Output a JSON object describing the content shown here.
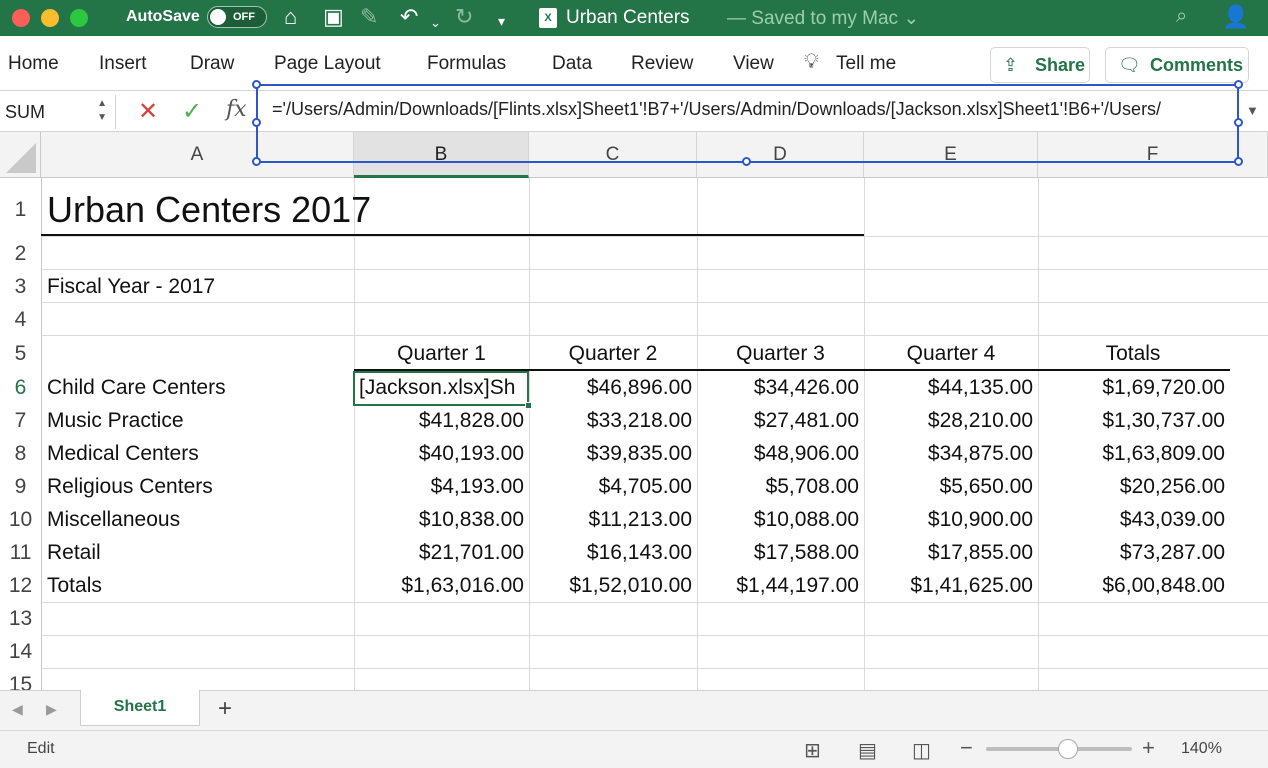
{
  "titlebar": {
    "autosave_label": "AutoSave",
    "autosave_state": "OFF",
    "file_badge": "X",
    "doc_name": "Urban Centers",
    "doc_status": "— Saved to my Mac ⌄"
  },
  "ribbon": {
    "tabs": [
      "Home",
      "Insert",
      "Draw",
      "Page Layout",
      "Formulas",
      "Data",
      "Review",
      "View"
    ],
    "tell_me": "Tell me",
    "share": "Share",
    "comments": "Comments"
  },
  "formula_bar": {
    "name_box": "SUM",
    "formula": "='/Users/Admin/Downloads/[Flints.xlsx]Sheet1'!B7+'/Users/Admin/Downloads/[Jackson.xlsx]Sheet1'!B6+'/Users/"
  },
  "grid": {
    "columns": [
      "A",
      "B",
      "C",
      "D",
      "E",
      "F"
    ],
    "rows": [
      "1",
      "2",
      "3",
      "4",
      "5",
      "6",
      "7",
      "8",
      "9",
      "10",
      "11",
      "12",
      "13",
      "14",
      "15"
    ],
    "title": "Urban Centers 2017",
    "fiscal_year": "Fiscal Year - 2017",
    "headers": [
      "Quarter 1",
      "Quarter 2",
      "Quarter 3",
      "Quarter 4",
      "Totals"
    ],
    "data_rows": [
      {
        "label": "Child Care Centers",
        "values": [
          "[Jackson.xlsx]Sh",
          "$46,896.00",
          "$34,426.00",
          "$44,135.00",
          "$1,69,720.00"
        ]
      },
      {
        "label": "Music Practice",
        "values": [
          "$41,828.00",
          "$33,218.00",
          "$27,481.00",
          "$28,210.00",
          "$1,30,737.00"
        ]
      },
      {
        "label": "Medical Centers",
        "values": [
          "$40,193.00",
          "$39,835.00",
          "$48,906.00",
          "$34,875.00",
          "$1,63,809.00"
        ]
      },
      {
        "label": "Religious Centers",
        "values": [
          "$4,193.00",
          "$4,705.00",
          "$5,708.00",
          "$5,650.00",
          "$20,256.00"
        ]
      },
      {
        "label": "Miscellaneous",
        "values": [
          "$10,838.00",
          "$11,213.00",
          "$10,088.00",
          "$10,900.00",
          "$43,039.00"
        ]
      },
      {
        "label": "Retail",
        "values": [
          "$21,701.00",
          "$16,143.00",
          "$17,588.00",
          "$17,855.00",
          "$73,287.00"
        ]
      },
      {
        "label": "Totals",
        "values": [
          "$1,63,016.00",
          "$1,52,010.00",
          "$1,44,197.00",
          "$1,41,625.00",
          "$6,00,848.00"
        ]
      }
    ]
  },
  "sheets": {
    "tabs": [
      "Sheet1"
    ],
    "add": "+"
  },
  "statusbar": {
    "mode": "Edit",
    "zoom": "140%"
  },
  "colors": {
    "excel_green": "#237446",
    "selection_blue": "#2b58c6"
  }
}
